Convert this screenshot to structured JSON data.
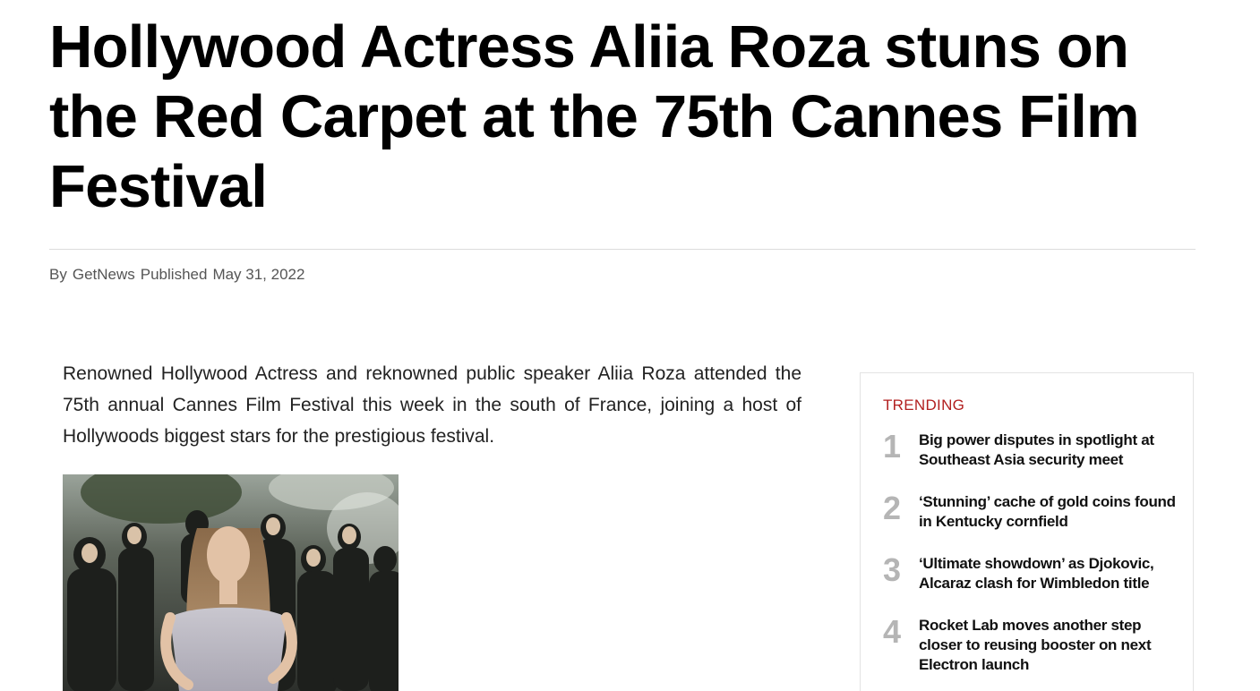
{
  "article": {
    "headline": "Hollywood Actress Aliia Roza stuns on the Red Carpet at the 75th Cannes Film Festival",
    "byline": {
      "by_label": "By",
      "author": "GetNews",
      "published_label": "Published",
      "date": "May 31, 2022"
    },
    "intro": "Renowned Hollywood Actress and reknowned public speaker Aliia Roza attended the 75th annual Cannes Film Festival this week in the south of France, joining a host of Hollywoods biggest stars for the prestigious festival."
  },
  "trending": {
    "title": "TRENDING",
    "items": [
      {
        "number": "1",
        "text": "Big power disputes in spotlight at Southeast Asia security meet"
      },
      {
        "number": "2",
        "text": "‘Stunning’ cache of gold coins found in Kentucky cornfield"
      },
      {
        "number": "3",
        "text": "‘Ultimate showdown’ as Djokovic, Alcaraz clash for Wimbledon title"
      },
      {
        "number": "4",
        "text": "Rocket Lab moves another step closer to reusing booster on next Electron launch"
      }
    ]
  },
  "colors": {
    "accent": "#b21f1f",
    "number_gray": "#b5b5b5"
  }
}
